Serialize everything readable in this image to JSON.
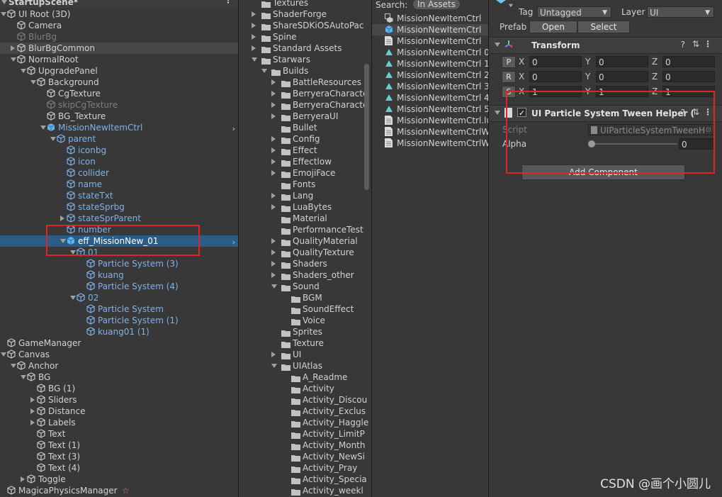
{
  "hierarchy": {
    "scene_name": "StartupScene*",
    "rows": [
      {
        "label": "UI Root (3D)",
        "depth": 0,
        "arrow": "d",
        "color": "white",
        "icon": "gameobject-root-icon"
      },
      {
        "label": "Camera",
        "depth": 1,
        "arrow": "",
        "color": "white",
        "icon": "cube-icon"
      },
      {
        "label": "BlurBg",
        "depth": 1,
        "arrow": "",
        "color": "dim",
        "icon": "cube-icon"
      },
      {
        "label": "BlurBgCommon",
        "depth": 1,
        "arrow": "r",
        "color": "white",
        "icon": "cube-icon",
        "gray": true
      },
      {
        "label": "NormalRoot",
        "depth": 1,
        "arrow": "d",
        "color": "white",
        "icon": "cube-icon"
      },
      {
        "label": "UpgradePanel",
        "depth": 2,
        "arrow": "d",
        "color": "white",
        "icon": "cube-icon"
      },
      {
        "label": "Background",
        "depth": 3,
        "arrow": "d",
        "color": "white",
        "icon": "cube-icon"
      },
      {
        "label": "CgTexture",
        "depth": 4,
        "arrow": "",
        "color": "white",
        "icon": "cube-icon"
      },
      {
        "label": "skipCgTexture",
        "depth": 4,
        "arrow": "",
        "color": "dim",
        "icon": "cube-icon"
      },
      {
        "label": "BG_Texture",
        "depth": 4,
        "arrow": "",
        "color": "white",
        "icon": "cube-icon"
      },
      {
        "label": "MissionNewItemCtrl",
        "depth": 4,
        "arrow": "d",
        "color": "blue",
        "icon": "prefab-icon",
        "chevron": true
      },
      {
        "label": "parent",
        "depth": 5,
        "arrow": "d",
        "color": "blue",
        "icon": "cube-icon"
      },
      {
        "label": "iconbg",
        "depth": 6,
        "arrow": "",
        "color": "blue",
        "icon": "cube-icon"
      },
      {
        "label": "icon",
        "depth": 6,
        "arrow": "",
        "color": "blue",
        "icon": "cube-icon"
      },
      {
        "label": "collider",
        "depth": 6,
        "arrow": "",
        "color": "blue",
        "icon": "cube-icon"
      },
      {
        "label": "name",
        "depth": 6,
        "arrow": "",
        "color": "blue",
        "icon": "cube-icon"
      },
      {
        "label": "stateTxt",
        "depth": 6,
        "arrow": "",
        "color": "blue",
        "icon": "cube-icon"
      },
      {
        "label": "stateSprbg",
        "depth": 6,
        "arrow": "",
        "color": "blue",
        "icon": "cube-icon"
      },
      {
        "label": "stateSprParent",
        "depth": 6,
        "arrow": "r",
        "color": "blue",
        "icon": "cube-icon"
      },
      {
        "label": "number",
        "depth": 6,
        "arrow": "",
        "color": "blue",
        "icon": "cube-icon"
      },
      {
        "label": "eff_MissionNew_01",
        "depth": 6,
        "arrow": "d",
        "color": "sel",
        "icon": "prefab-icon",
        "selected": true,
        "chevron": true
      },
      {
        "label": "01",
        "depth": 7,
        "arrow": "d",
        "color": "blue",
        "icon": "cube-icon"
      },
      {
        "label": "Particle System (3)",
        "depth": 8,
        "arrow": "",
        "color": "blue",
        "icon": "cube-icon"
      },
      {
        "label": "kuang",
        "depth": 8,
        "arrow": "",
        "color": "blue",
        "icon": "cube-icon"
      },
      {
        "label": "Particle System (4)",
        "depth": 8,
        "arrow": "",
        "color": "blue",
        "icon": "cube-icon"
      },
      {
        "label": "02",
        "depth": 7,
        "arrow": "d",
        "color": "blue",
        "icon": "cube-icon"
      },
      {
        "label": "Particle System",
        "depth": 8,
        "arrow": "",
        "color": "blue",
        "icon": "cube-icon"
      },
      {
        "label": "Particle System (1)",
        "depth": 8,
        "arrow": "",
        "color": "blue",
        "icon": "cube-icon"
      },
      {
        "label": "kuang01 (1)",
        "depth": 8,
        "arrow": "",
        "color": "blue",
        "icon": "cube-icon"
      },
      {
        "label": "GameManager",
        "depth": 0,
        "arrow": "",
        "color": "white",
        "icon": "cube-icon"
      },
      {
        "label": "Canvas",
        "depth": 0,
        "arrow": "d",
        "color": "white",
        "icon": "cube-icon"
      },
      {
        "label": "Anchor",
        "depth": 1,
        "arrow": "d",
        "color": "white",
        "icon": "cube-icon"
      },
      {
        "label": "BG",
        "depth": 2,
        "arrow": "d",
        "color": "white",
        "icon": "cube-icon"
      },
      {
        "label": "BG (1)",
        "depth": 3,
        "arrow": "",
        "color": "white",
        "icon": "cube-icon"
      },
      {
        "label": "Sliders",
        "depth": 3,
        "arrow": "r",
        "color": "white",
        "icon": "cube-icon"
      },
      {
        "label": "Distance",
        "depth": 3,
        "arrow": "r",
        "color": "white",
        "icon": "cube-icon"
      },
      {
        "label": "Labels",
        "depth": 3,
        "arrow": "r",
        "color": "white",
        "icon": "cube-icon"
      },
      {
        "label": "Text",
        "depth": 3,
        "arrow": "",
        "color": "white",
        "icon": "cube-icon"
      },
      {
        "label": "Text (1)",
        "depth": 3,
        "arrow": "",
        "color": "white",
        "icon": "cube-icon"
      },
      {
        "label": "Text (3)",
        "depth": 3,
        "arrow": "",
        "color": "white",
        "icon": "cube-icon"
      },
      {
        "label": "Text (4)",
        "depth": 3,
        "arrow": "",
        "color": "white",
        "icon": "cube-icon"
      },
      {
        "label": "Toggle",
        "depth": 2,
        "arrow": "r",
        "color": "white",
        "icon": "cube-icon"
      },
      {
        "label": "MagicaPhysicsManager",
        "depth": 0,
        "arrow": "",
        "color": "white",
        "icon": "cube-icon",
        "star": true
      }
    ]
  },
  "folders": {
    "rows": [
      {
        "label": "Textures",
        "depth": 1,
        "arrow": ""
      },
      {
        "label": "ShaderForge",
        "depth": 1,
        "arrow": "r"
      },
      {
        "label": "ShareSDKiOSAutoPac",
        "depth": 1,
        "arrow": "r"
      },
      {
        "label": "Spine",
        "depth": 1,
        "arrow": "r"
      },
      {
        "label": "Standard Assets",
        "depth": 1,
        "arrow": "r"
      },
      {
        "label": "Starwars",
        "depth": 1,
        "arrow": "d"
      },
      {
        "label": "Builds",
        "depth": 2,
        "arrow": "d"
      },
      {
        "label": "BattleResources",
        "depth": 3,
        "arrow": "r"
      },
      {
        "label": "BerryeraCharacte",
        "depth": 3,
        "arrow": "r"
      },
      {
        "label": "BerryeraCharacte",
        "depth": 3,
        "arrow": "r"
      },
      {
        "label": "BerryeraUI",
        "depth": 3,
        "arrow": "r"
      },
      {
        "label": "Bullet",
        "depth": 3,
        "arrow": ""
      },
      {
        "label": "Config",
        "depth": 3,
        "arrow": "r"
      },
      {
        "label": "Effect",
        "depth": 3,
        "arrow": "r"
      },
      {
        "label": "Effectlow",
        "depth": 3,
        "arrow": "r"
      },
      {
        "label": "EmojiFace",
        "depth": 3,
        "arrow": "r"
      },
      {
        "label": "Fonts",
        "depth": 3,
        "arrow": ""
      },
      {
        "label": "Lang",
        "depth": 3,
        "arrow": "r"
      },
      {
        "label": "LuaBytes",
        "depth": 3,
        "arrow": "r"
      },
      {
        "label": "Material",
        "depth": 3,
        "arrow": ""
      },
      {
        "label": "PerformanceTest",
        "depth": 3,
        "arrow": ""
      },
      {
        "label": "QualityMaterial",
        "depth": 3,
        "arrow": "r"
      },
      {
        "label": "QualityTexture",
        "depth": 3,
        "arrow": "r"
      },
      {
        "label": "Shaders",
        "depth": 3,
        "arrow": "r"
      },
      {
        "label": "Shaders_other",
        "depth": 3,
        "arrow": "r"
      },
      {
        "label": "Sound",
        "depth": 3,
        "arrow": "d"
      },
      {
        "label": "BGM",
        "depth": 4,
        "arrow": ""
      },
      {
        "label": "SoundEffect",
        "depth": 4,
        "arrow": ""
      },
      {
        "label": "Voice",
        "depth": 4,
        "arrow": ""
      },
      {
        "label": "Sprites",
        "depth": 3,
        "arrow": ""
      },
      {
        "label": "Texture",
        "depth": 3,
        "arrow": ""
      },
      {
        "label": "UI",
        "depth": 3,
        "arrow": "r"
      },
      {
        "label": "UIAtlas",
        "depth": 3,
        "arrow": "d"
      },
      {
        "label": "A_Readme",
        "depth": 4,
        "arrow": ""
      },
      {
        "label": "Activity",
        "depth": 4,
        "arrow": ""
      },
      {
        "label": "Activity_Discou",
        "depth": 4,
        "arrow": ""
      },
      {
        "label": "Activity_Exclus",
        "depth": 4,
        "arrow": ""
      },
      {
        "label": "Activity_Haggle",
        "depth": 4,
        "arrow": ""
      },
      {
        "label": "Activity_LimitP",
        "depth": 4,
        "arrow": ""
      },
      {
        "label": "Activity_Month",
        "depth": 4,
        "arrow": ""
      },
      {
        "label": "Activity_NewSi",
        "depth": 4,
        "arrow": ""
      },
      {
        "label": "Activity_Pray",
        "depth": 4,
        "arrow": ""
      },
      {
        "label": "Activity_Specia",
        "depth": 4,
        "arrow": ""
      },
      {
        "label": "Activity_weekl",
        "depth": 4,
        "arrow": ""
      }
    ]
  },
  "assets": {
    "search_label": "Search:",
    "search_scope": "In Assets",
    "rows": [
      {
        "label": "MissionNewItemCtrl",
        "icon": "prefab-variant-icon"
      },
      {
        "label": "MissionNewItemCtrl",
        "icon": "prefab-icon",
        "selected": true
      },
      {
        "label": "MissionNewItemCtrl",
        "icon": "file-icon"
      },
      {
        "label": "MissionNewItemCtrl 0",
        "icon": "anim-icon"
      },
      {
        "label": "MissionNewItemCtrl 1",
        "icon": "anim-icon"
      },
      {
        "label": "MissionNewItemCtrl 2",
        "icon": "anim-icon"
      },
      {
        "label": "MissionNewItemCtrl 3",
        "icon": "anim-icon"
      },
      {
        "label": "MissionNewItemCtrl 4",
        "icon": "anim-icon"
      },
      {
        "label": "MissionNewItemCtrl 5",
        "icon": "anim-icon"
      },
      {
        "label": "MissionNewItemCtrl.lua",
        "icon": "file-icon"
      },
      {
        "label": "MissionNewItemCtrlWi",
        "icon": "file-icon"
      },
      {
        "label": "MissionNewItemCtrlWi",
        "icon": "file-icon"
      }
    ]
  },
  "inspector": {
    "tag_label": "Tag",
    "tag_value": "Untagged",
    "layer_label": "Layer",
    "layer_value": "UI",
    "prefab_label": "Prefab",
    "prefab_open": "Open",
    "prefab_select": "Select",
    "transform": {
      "title": "Transform",
      "rows": [
        {
          "btn": "P",
          "x": "0",
          "y": "0",
          "z": "0"
        },
        {
          "btn": "R",
          "x": "0",
          "y": "0",
          "z": "0"
        },
        {
          "btn": "S",
          "x": "1",
          "y": "1",
          "z": "1"
        }
      ],
      "axis_x": "X",
      "axis_y": "Y",
      "axis_z": "Z"
    },
    "component": {
      "title": "UI Particle System Tween Helper (",
      "script_label": "Script",
      "script_value": "UIParticleSystemTweenH",
      "alpha_label": "Alpha",
      "alpha_value": "0",
      "alpha_level": 0
    },
    "add_component": "Add Component"
  },
  "watermark": "CSDN @画个小圆儿",
  "colors": {
    "panel_bg": "#383838",
    "selection": "#2c5d87",
    "prefab_text": "#7ab2ee",
    "highlight_box": "#e0242a"
  }
}
